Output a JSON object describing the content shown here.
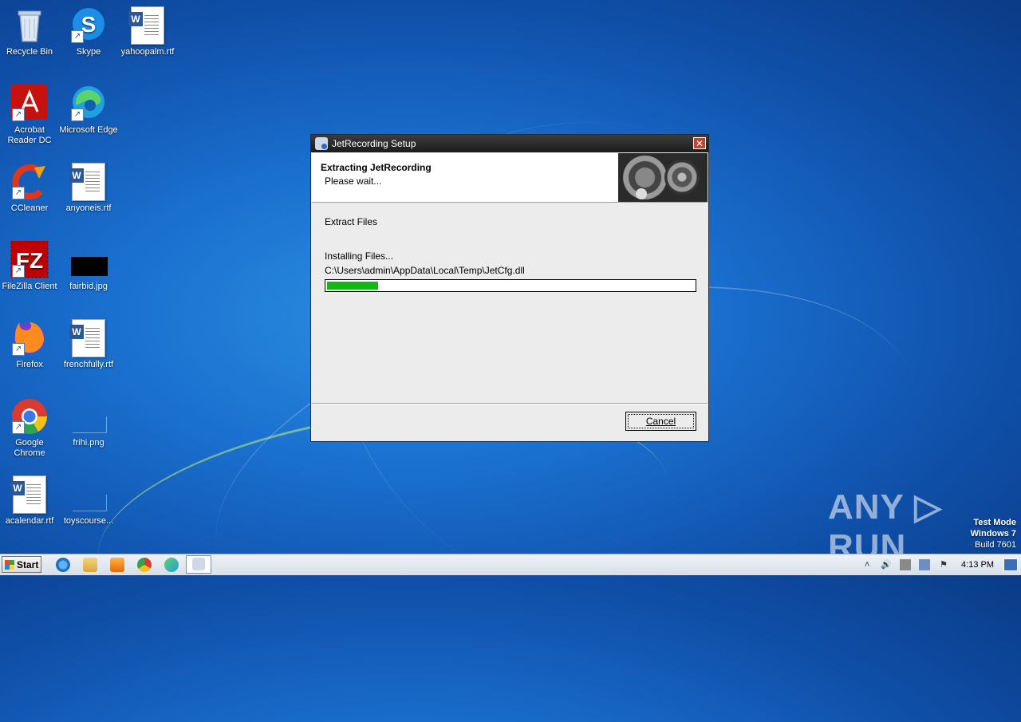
{
  "desktop": {
    "icons": [
      {
        "label": "Recycle Bin"
      },
      {
        "label": "Skype"
      },
      {
        "label": "yahoopalm.rtf"
      },
      {
        "label": "Acrobat Reader DC"
      },
      {
        "label": "Microsoft Edge"
      },
      {
        "label": "CCleaner"
      },
      {
        "label": "anyoneis.rtf"
      },
      {
        "label": "FileZilla Client"
      },
      {
        "label": "fairbid.jpg"
      },
      {
        "label": "Firefox"
      },
      {
        "label": "frenchfully.rtf"
      },
      {
        "label": "Google Chrome"
      },
      {
        "label": "frihi.png"
      },
      {
        "label": "acalendar.rtf"
      },
      {
        "label": "toyscourse..."
      }
    ]
  },
  "dialog": {
    "title": "JetRecording Setup",
    "close_glyph": "✕",
    "header_title": "Extracting JetRecording",
    "header_subtitle": "Please wait...",
    "section_label": "Extract Files",
    "status": "Installing Files...",
    "current_file": "C:\\Users\\admin\\AppData\\Local\\Temp\\JetCfg.dll",
    "progress_fraction": 0.14,
    "progress_color": "#14b814",
    "cancel_label": "Cancel"
  },
  "watermark": {
    "text": "ANY ▷ RUN",
    "line1": "Test Mode",
    "line2": "Windows 7",
    "line3": "Build 7601"
  },
  "taskbar": {
    "start_label": "Start",
    "clock": "4:13 PM",
    "pinned": [
      "internet-explorer-icon",
      "file-explorer-icon",
      "media-player-icon",
      "chrome-icon",
      "edge-icon",
      "setup-icon"
    ],
    "tray": {
      "chevron": "˄",
      "speaker": "🔊",
      "flag": "⚑"
    }
  }
}
